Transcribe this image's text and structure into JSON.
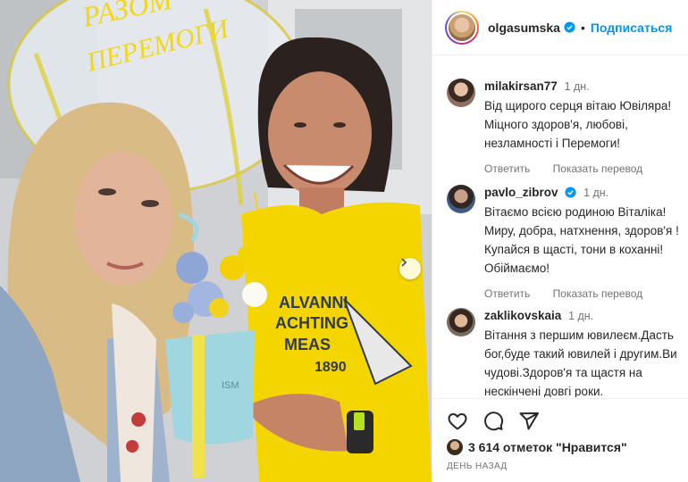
{
  "post": {
    "balloon_text_line1": "РАЗОМ",
    "balloon_text_line2": "ПЕРЕМОГИ",
    "box_label": "ISM",
    "shirt_text_line1": "ALVANNI",
    "shirt_text_line2": "ACHTING",
    "shirt_text_line3": "MEAS",
    "shirt_text_line4": "1890",
    "next_icon": "chevron-right-icon"
  },
  "header": {
    "username": "olgasumska",
    "separator": "•",
    "follow_label": "Подписаться",
    "verified_icon": "verified-badge-icon"
  },
  "comments": [
    {
      "user": "milakirsan77",
      "time": "1 дн.",
      "text": "Від щирого серця вітаю Ювіляра! Міцного здоров'я, любові, незламності і Перемоги!",
      "reply": "Ответить",
      "translate": "Показать перевод"
    },
    {
      "user": "pavlo_zibrov",
      "verified": true,
      "time": "1 дн.",
      "text": "Вітаємо всією родиною Віталіка! Миру, добра, натхнення, здоров'я ! Купайся в щасті, тони в коханні! Обіймаємо!",
      "reply": "Ответить",
      "translate": "Показать перевод"
    },
    {
      "user": "zaklikovskaia",
      "time": "1 дн.",
      "text": "Вітання з першим ювилеєм.Дасть бог,буде такий ювилей і другим.Ви чудові.Здоров'я та щастя на нескінчені довгі роки."
    }
  ],
  "actions": {
    "like_icon": "heart-icon",
    "comment_icon": "comment-icon",
    "share_icon": "share-icon"
  },
  "likes_text": "3 614 отметок \"Нравится\"",
  "date_text": "ДЕНЬ НАЗАД",
  "colors": {
    "follow": "#0095f6",
    "verified": "#0095f6",
    "secondary_text": "#737373",
    "shirt": "#f4d500"
  }
}
